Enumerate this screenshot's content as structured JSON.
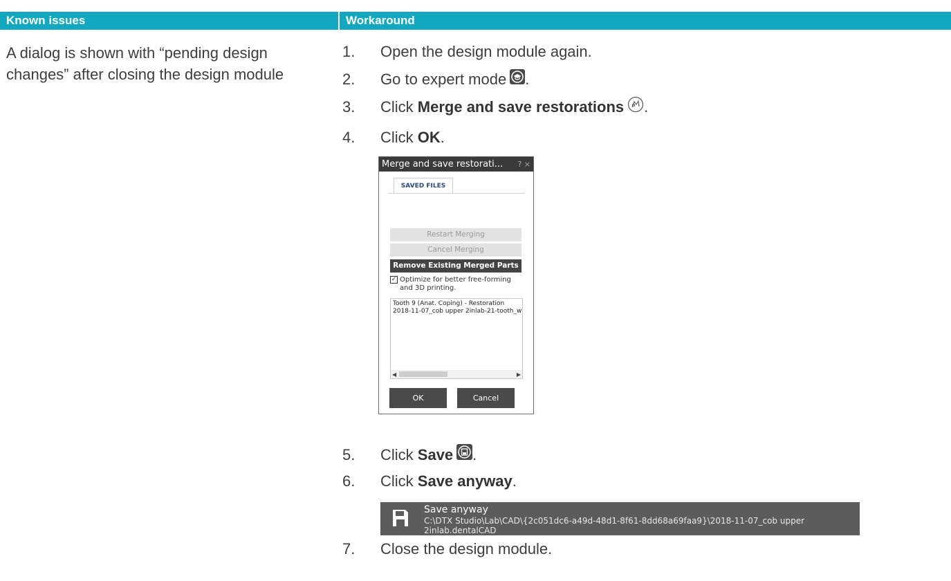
{
  "table": {
    "header_issues": "Known issues",
    "header_workaround": "Workaround",
    "issue_text": "A dialog is shown with “pending design changes” after closing the design module"
  },
  "steps": [
    {
      "num": "1.",
      "text": "Open the design module again."
    },
    {
      "num": "2.",
      "text": "Go to expert mode"
    },
    {
      "num": "3.",
      "pre": "Click ",
      "bold": "Merge and save restorations"
    },
    {
      "num": "4.",
      "pre": "Click ",
      "bold": "OK",
      "post": "."
    },
    {
      "num": "5.",
      "pre": "Click ",
      "bold": "Save"
    },
    {
      "num": "6.",
      "pre": "Click ",
      "bold": "Save anyway",
      "post": "."
    },
    {
      "num": "7.",
      "text": "Close the design module."
    }
  ],
  "dialog": {
    "title": "Merge and save restorati...",
    "title_controls": "?  ×",
    "tab": "SAVED FILES",
    "restart": "Restart Merging",
    "cancel_merging": "Cancel Merging",
    "remove": "Remove Existing Merged Parts",
    "optimize_line1": "Optimize for better free-forming",
    "optimize_line2": "and 3D printing.",
    "list_line1": "Tooth 9 (Anat. Coping) - Restoration",
    "list_line2": "2018-11-07_cob upper 2inlab-21-tooth_wi",
    "ok": "OK",
    "cancel": "Cancel"
  },
  "savebar": {
    "title": "Save anyway",
    "path": "C:\\DTX Studio\\Lab\\CAD\\{2c051dc6-a49d-48d1-8f61-8dd68a69faa9}\\2018-11-07_cob upper 2inlab.dentalCAD"
  },
  "colors": {
    "header": "#13a8c0",
    "dialog_titlebar": "#3a3a3a",
    "savebar": "#5c5c5c"
  }
}
